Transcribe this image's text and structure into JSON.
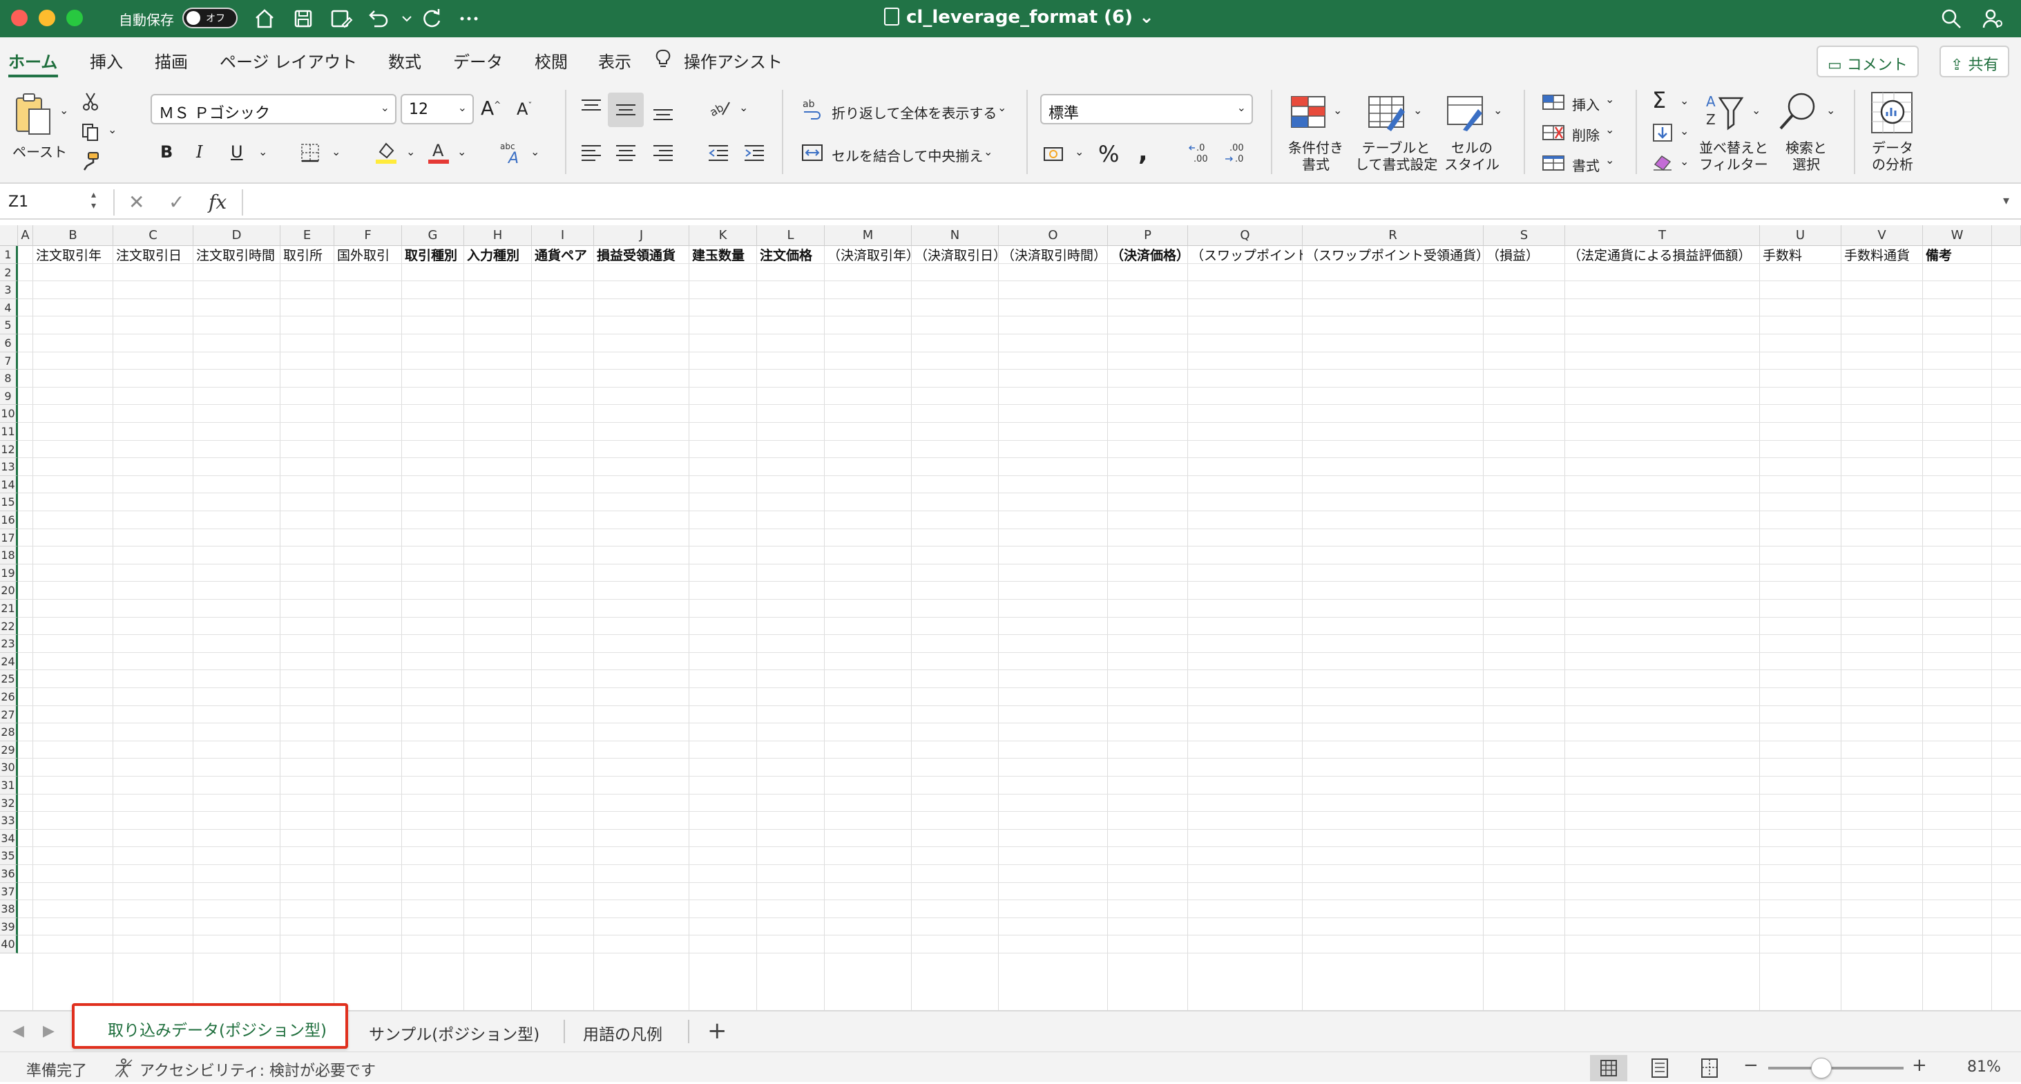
{
  "titlebar": {
    "autosave_label": "自動保存",
    "autosave_state": "オフ",
    "document_title": "cl_leverage_format (6)",
    "icons": [
      "home-icon",
      "save-icon",
      "save-as-icon",
      "undo-icon",
      "redo-icon",
      "more-icon",
      "search-icon",
      "account-icon"
    ]
  },
  "ribbon_tabs": [
    "ホーム",
    "挿入",
    "描画",
    "ページ レイアウト",
    "数式",
    "データ",
    "校閲",
    "表示"
  ],
  "assist_label": "操作アシスト",
  "comment_label": "コメント",
  "share_label": "共有",
  "ribbon": {
    "paste_label": "ペースト",
    "font_name": "ＭＳ Ｐゴシック",
    "font_size": "12",
    "bold": "B",
    "italic": "I",
    "underline": "U",
    "wrap_text_label": "折り返して全体を表示する",
    "merge_center_label": "セルを結合して中央揃え",
    "number_format": "標準",
    "conditional_format_label": [
      "条件付き",
      "書式"
    ],
    "format_as_table_label": [
      "テーブルと",
      "して書式設定"
    ],
    "cell_styles_label": [
      "セルの",
      "スタイル"
    ],
    "insert_label": "挿入",
    "delete_label": "削除",
    "format_label": "書式",
    "sort_filter_label": [
      "並べ替えと",
      "フィルター"
    ],
    "find_select_label": [
      "検索と",
      "選択"
    ],
    "analyze_label": [
      "データ",
      "の分析"
    ],
    "accent": "#217346"
  },
  "formula_bar": {
    "name_box": "Z1",
    "fx_label": "fx",
    "formula": ""
  },
  "sheet": {
    "columns": [
      "A",
      "B",
      "C",
      "D",
      "E",
      "F",
      "G",
      "H",
      "I",
      "J",
      "K",
      "L",
      "M",
      "N",
      "O",
      "P",
      "Q",
      "R",
      "S",
      "T",
      "U",
      "V",
      "W"
    ],
    "header_row": [
      {
        "text": "",
        "bold": false
      },
      {
        "text": "注文取引年",
        "bold": false
      },
      {
        "text": "注文取引日",
        "bold": false
      },
      {
        "text": "注文取引時間",
        "bold": false
      },
      {
        "text": "取引所",
        "bold": false
      },
      {
        "text": "国外取引",
        "bold": false
      },
      {
        "text": "取引種別",
        "bold": true
      },
      {
        "text": "入力種別",
        "bold": true
      },
      {
        "text": "通貨ペア",
        "bold": true
      },
      {
        "text": "損益受領通貨",
        "bold": true
      },
      {
        "text": "建玉数量",
        "bold": true
      },
      {
        "text": "注文価格",
        "bold": true
      },
      {
        "text": "（決済取引年）",
        "bold": false
      },
      {
        "text": "（決済取引日）",
        "bold": false
      },
      {
        "text": "（決済取引時間）",
        "bold": false
      },
      {
        "text": "（決済価格）",
        "bold": true
      },
      {
        "text": "（スワップポイント）",
        "bold": false
      },
      {
        "text": "（スワップポイント受領通貨）",
        "bold": false
      },
      {
        "text": "（損益）",
        "bold": false
      },
      {
        "text": "（法定通貨による損益評価額）",
        "bold": false
      },
      {
        "text": "手数料",
        "bold": false
      },
      {
        "text": "手数料通貨",
        "bold": false
      },
      {
        "text": "備考",
        "bold": true
      }
    ],
    "row_count": 40
  },
  "sheet_tabs": [
    {
      "label": "取り込みデータ(ポジション型)",
      "active": true
    },
    {
      "label": "サンプル(ポジション型)",
      "active": false
    },
    {
      "label": "用語の凡例",
      "active": false
    }
  ],
  "add_sheet_label": "+",
  "status": {
    "ready": "準備完了",
    "accessibility": "アクセシビリティ: 検討が必要です",
    "zoom": "81%",
    "zoom_level_percent": 81
  }
}
